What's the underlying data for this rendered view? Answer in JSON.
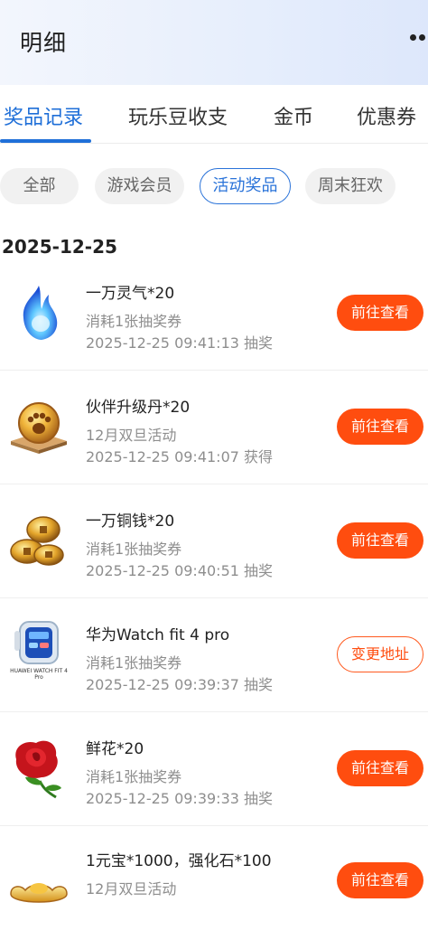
{
  "header": {
    "title": "明细"
  },
  "tabs": [
    {
      "label": "奖品记录",
      "active": true
    },
    {
      "label": "玩乐豆收支",
      "active": false
    },
    {
      "label": "金币",
      "active": false
    },
    {
      "label": "优惠券",
      "active": false
    }
  ],
  "filters": [
    {
      "label": "全部",
      "active": false
    },
    {
      "label": "游戏会员",
      "active": false
    },
    {
      "label": "活动奖品",
      "active": true
    },
    {
      "label": "周末狂欢",
      "active": false
    }
  ],
  "date_group": "2025-12-25",
  "records": [
    {
      "name": "一万灵气*20",
      "desc": "消耗1张抽奖券",
      "time": "2025-12-25 09:41:13 抽奖",
      "button": "前往查看",
      "icon": "blue-spirit-flame-icon"
    },
    {
      "name": "伙伴升级丹*20",
      "desc": "12月双旦活动",
      "time": "2025-12-25 09:41:07 获得",
      "button": "前往查看",
      "icon": "gold-paw-pill-icon"
    },
    {
      "name": "一万铜钱*20",
      "desc": "消耗1张抽奖券",
      "time": "2025-12-25 09:40:51 抽奖",
      "button": "前往查看",
      "icon": "copper-coins-icon"
    },
    {
      "name": "华为Watch fit 4 pro",
      "desc": "消耗1张抽奖券",
      "time": "2025-12-25 09:39:37 抽奖",
      "button": "变更地址",
      "icon": "smartwatch-icon",
      "thumb_text": "HUAWEI WATCH FIT 4 Pro"
    },
    {
      "name": "鲜花*20",
      "desc": "消耗1张抽奖券",
      "time": "2025-12-25 09:39:33 抽奖",
      "button": "前往查看",
      "icon": "red-rose-icon"
    },
    {
      "name": "1元宝*1000，强化石*100",
      "desc": "12月双旦活动",
      "time": "",
      "button": "前往查看",
      "icon": "gold-ingot-icon"
    }
  ],
  "colors": {
    "accent": "#1f6fd8",
    "button": "#ff4d0f",
    "muted": "#8e8e8e"
  }
}
